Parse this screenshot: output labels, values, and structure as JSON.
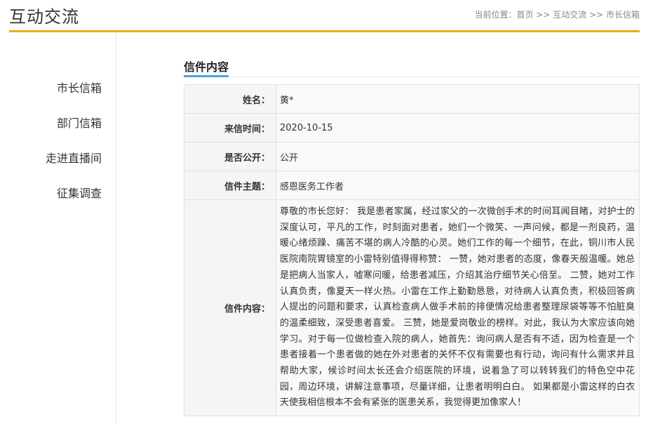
{
  "header": {
    "title": "互动交流",
    "breadcrumb_prefix": "当前位置：",
    "breadcrumb": [
      "首页",
      "互动交流",
      "市长信箱"
    ],
    "breadcrumb_sep": " >> "
  },
  "sidebar": {
    "items": [
      {
        "label": "市长信箱"
      },
      {
        "label": "部门信箱"
      },
      {
        "label": "走进直播间"
      },
      {
        "label": "征集调查"
      }
    ]
  },
  "main": {
    "section_title": "信件内容",
    "fields": {
      "name_label": "姓名：",
      "name_value": "黄*",
      "date_label": "来信时间：",
      "date_value": "2020-10-15",
      "public_label": "是否公开：",
      "public_value": "公开",
      "subject_label": "信件主题：",
      "subject_value": "感恩医务工作者",
      "content_label": "信件内容：",
      "content_value": "尊敬的市长您好： 我是患者家属，经过家父的一次微创手术的时间耳闻目睹，对护士的深度认可，平凡的工作，时刻面对患者，她们一个微笑、一声问候，都是一剂良药，温暖心绪烦躁、痛苦不堪的病人冷酷的心灵。她们工作的每一个细节，在此，铜川市人民医院南院胃镜室的小雷特别值得得称赞： 一赞，她对患者的态度，像春天般温暖。她总是把病人当家人，嘘寒问暖，给患者减压，介绍其治疗细节关心倍至。        二赞，她对工作认真负责，像夏天一样火热。小雷在工作上勤勤恳恳，对待病人认真负责，积极回答病人提出的问题和要求，认真检查病人做手术前的排便情况给患者整理尿袋等等不怕脏臭的温柔细致，深受患者喜爱。     三赞，她是爱岗敬业的榜样。对此，我认为大家应该向她学习。对于每一位做检查入院的病人，她首先：询问病人是否有不适，因为检查是一个患者接着一个患者做的她在外对患者的关怀不仅有需要也有行动，询问有什么需求并且帮助大家，候诊时间太长还会介绍医院的环境，说着急了可以转转我们的特色空中花园，周边环境，讲解注意事项，尽量详细，让患者明明白白。 如果都是小雷这样的白衣天使我相信根本不会有紧张的医患关系，我觉得更加像家人！"
    }
  },
  "colors": {
    "accent_orange": "#f5a623",
    "accent_blue": "#4aa3df"
  }
}
